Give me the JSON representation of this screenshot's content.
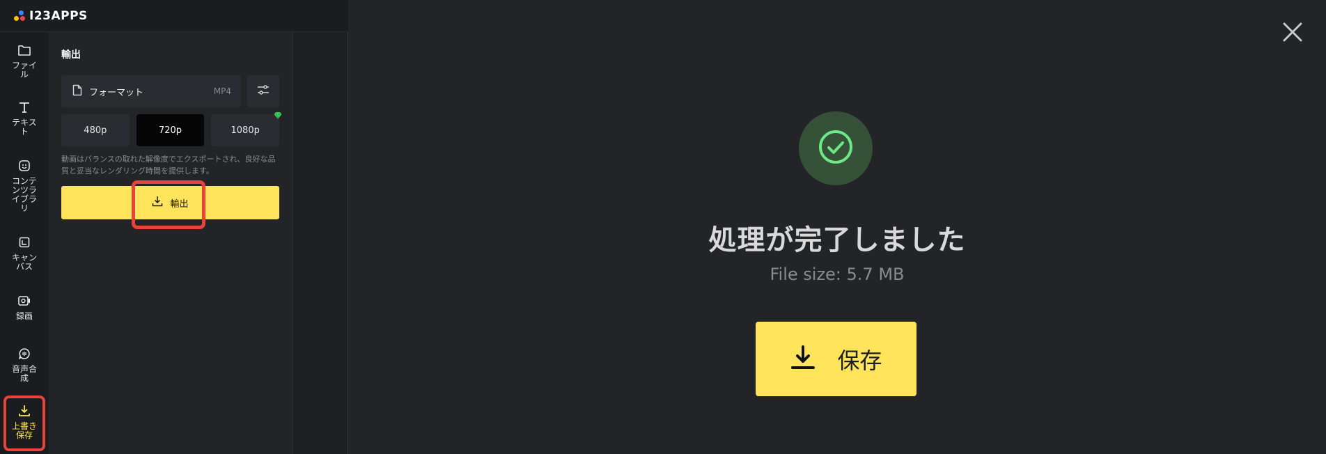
{
  "app": {
    "logo_text": "I23APPS"
  },
  "sidebar": {
    "items": [
      {
        "label": "ファイル",
        "icon": "folder-icon"
      },
      {
        "label": "テキスト",
        "icon": "text-icon"
      },
      {
        "label": "コンテンツライブラリ",
        "icon": "sticker-icon"
      },
      {
        "label": "キャンバス",
        "icon": "canvas-icon"
      },
      {
        "label": "録画",
        "icon": "record-icon"
      },
      {
        "label": "音声合成",
        "icon": "voice-icon"
      },
      {
        "label": "上書き保存",
        "icon": "download-icon",
        "active": true
      }
    ]
  },
  "export_panel": {
    "title": "輸出",
    "format_label": "フォーマット",
    "format_value": "MP4",
    "resolutions": [
      "480p",
      "720p",
      "1080p"
    ],
    "selected_resolution": "720p",
    "description": "動画はバランスの取れた解像度でエクスポートされ、良好な品質と妥当なレンダリング時間を提供します。",
    "export_button_label": "輸出"
  },
  "modal": {
    "title": "処理が完了しました",
    "file_size": "File size: 5.7 MB",
    "save_button_label": "保存"
  },
  "colors": {
    "accent_yellow": "#ffe45c",
    "highlight_red": "#e8423c",
    "success_green": "#6ee787",
    "success_circle_bg": "#355137",
    "premium_gem": "#3fd35a"
  }
}
